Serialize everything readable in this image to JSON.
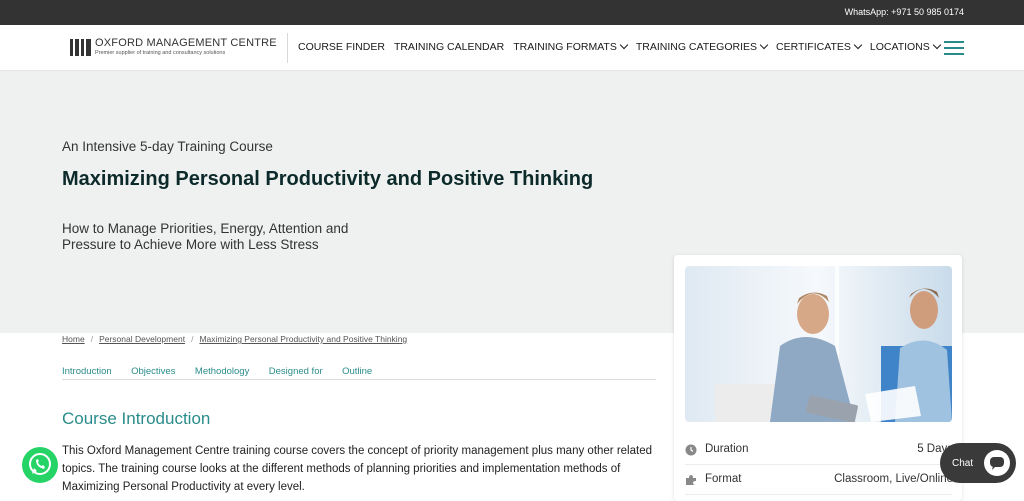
{
  "topbar": {
    "whatsapp": "WhatsApp: +971 50 985 0174"
  },
  "logo": {
    "name": "OXFORD MANAGEMENT CENTRE",
    "tagline": "Premier supplier of training and consultancy solutions"
  },
  "nav": {
    "items": [
      {
        "label": "COURSE FINDER",
        "dropdown": false
      },
      {
        "label": "TRAINING CALENDAR",
        "dropdown": false
      },
      {
        "label": "TRAINING FORMATS",
        "dropdown": true
      },
      {
        "label": "TRAINING CATEGORIES",
        "dropdown": true
      },
      {
        "label": "CERTIFICATES",
        "dropdown": true
      },
      {
        "label": "LOCATIONS",
        "dropdown": true
      }
    ],
    "menu_icon": "hamburger-icon"
  },
  "hero": {
    "eyebrow": "An Intensive 5-day Training Course",
    "title": "Maximizing Personal Productivity and Positive Thinking",
    "subtitle": "How to Manage Priorities, Energy, Attention and Pressure to Achieve More with Less Stress"
  },
  "breadcrumb": [
    "Home",
    "Personal Development",
    "Maximizing Personal Productivity and Positive Thinking"
  ],
  "tabs": [
    "Introduction",
    "Objectives",
    "Methodology",
    "Designed for",
    "Outline"
  ],
  "intro": {
    "title": "Course Introduction",
    "text": "This Oxford Management Centre training course covers the concept of priority management plus many other related topics. The training course looks at the different methods of planning priorities and implementation methods of Maximizing Personal Productivity at every level."
  },
  "card": {
    "rows": [
      {
        "label": "Duration",
        "value": "5 Days",
        "icon": "clock-icon"
      },
      {
        "label": "Format",
        "value": "Classroom, Live/Online",
        "icon": "puzzle-icon"
      }
    ]
  },
  "chat": {
    "label": "Chat"
  },
  "colors": {
    "accent": "#2a8c8a",
    "topbar": "#333333",
    "hero_bg": "#eff1f1",
    "title": "#0d2a2b"
  }
}
